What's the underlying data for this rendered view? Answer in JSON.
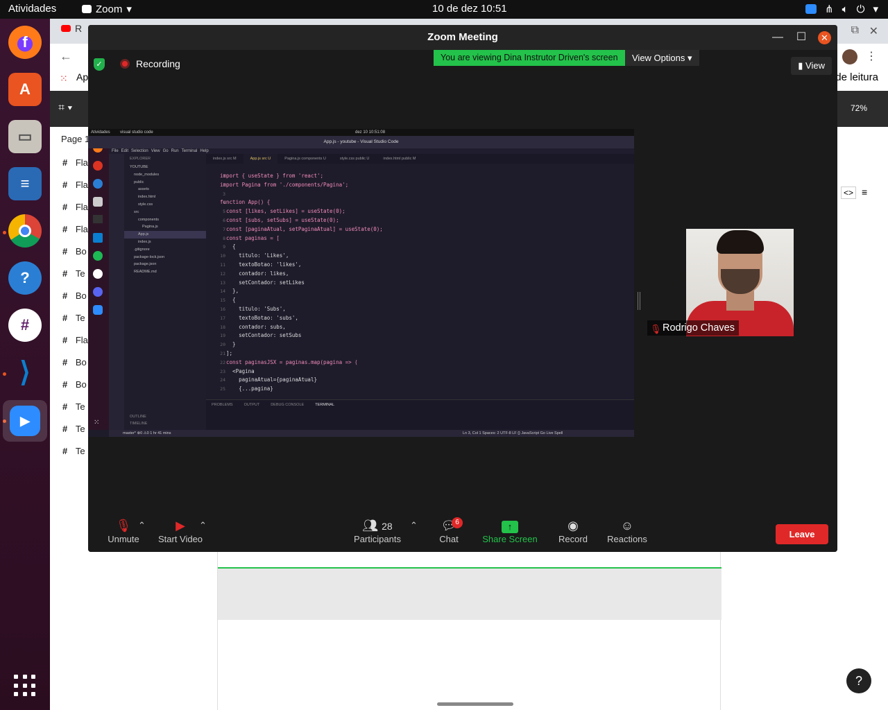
{
  "topbar": {
    "activities": "Atividades",
    "app_name": "Zoom",
    "clock": "10 de dez  10:51"
  },
  "background": {
    "tab_label": "R",
    "apps_label": "Ap",
    "zoom_level": "72%",
    "right_text": "de leitura",
    "page_label": "Page 1",
    "frame_rows": [
      "Fla",
      "Fla",
      "Fla",
      "Fla",
      "Bo",
      "Te",
      "Bo",
      "Te",
      "Fla",
      "Bo",
      "Bo",
      "Te",
      "Te",
      "Te"
    ]
  },
  "zoom": {
    "title": "Zoom Meeting",
    "recording": "Recording",
    "viewing_banner": "You are viewing Dina Instrutor Driven's screen",
    "view_options": "View Options",
    "view_button": "View",
    "participant_name": "Rodrigo Chaves",
    "controls": {
      "unmute": "Unmute",
      "start_video": "Start Video",
      "participants": "Participants",
      "participants_count": "28",
      "chat": "Chat",
      "chat_badge": "6",
      "share_screen": "Share Screen",
      "record": "Record",
      "reactions": "Reactions",
      "leave": "Leave"
    }
  },
  "shared_screen": {
    "activities": "Atividades",
    "app": "visual studio code",
    "clock": "dez 10  10:51:08",
    "window_title": "App.js - youtube - Visual Studio Code",
    "menu": [
      "File",
      "Edit",
      "Selection",
      "View",
      "Go",
      "Run",
      "Terminal",
      "Help"
    ],
    "tabs": [
      "index.js src M",
      "App.js src U",
      "Pagina.js components U",
      "style.css public U",
      "index.html public M"
    ],
    "explorer_title": "EXPLORER",
    "explorer_items": [
      "YOUTUBE",
      "node_modules",
      "public",
      "assets",
      "index.html",
      "style.css",
      "src",
      "components",
      "Pagina.js",
      "App.js",
      "index.js",
      ".gitignore",
      "package-lock.json",
      "package.json",
      "README.md"
    ],
    "outline": "OUTLINE",
    "timeline": "TIMELINE",
    "code_lines": [
      "import { useState } from 'react';",
      "import Pagina from './components/Pagina';",
      "",
      "function App() {",
      "  const [likes, setLikes] = useState(0);",
      "  const [subs, setSubs] = useState(0);",
      "  const [paginaAtual, setPaginaAtual] = useState(0);",
      "  const paginas = [",
      "    {",
      "      titulo: 'Likes',",
      "      textoBotao: 'likes',",
      "      contador: likes,",
      "      setContador: setLikes",
      "    },",
      "    {",
      "      titulo: 'Subs',",
      "      textoBotao: 'subs',",
      "      contador: subs,",
      "      setContador: setSubs",
      "    }",
      "  ];",
      "  const paginasJSX = paginas.map(pagina => (",
      "    <Pagina",
      "      paginaAtual={paginaAtual}",
      "      {...pagina}"
    ],
    "line_numbers": [
      "1",
      "2",
      "3",
      "4",
      "5",
      "6",
      "7",
      "8",
      "9",
      "10",
      "11",
      "12",
      "13",
      "14",
      "15",
      "16",
      "17",
      "18",
      "19",
      "20",
      "21",
      "22",
      "23",
      "24",
      "25"
    ],
    "panel_tabs": [
      "PROBLEMS",
      "OUTPUT",
      "DEBUG CONSOLE",
      "TERMINAL"
    ],
    "status_left": "master*   ⊗0 ⚠0   1 hr 41 mins",
    "status_right": "Ln 3, Col 1   Spaces: 2   UTF-8   LF   {} JavaScript   Go Live   Spell"
  },
  "colors": {
    "ubuntu_orange": "#e95420",
    "zoom_green": "#23c24a",
    "leave_red": "#e02828"
  }
}
